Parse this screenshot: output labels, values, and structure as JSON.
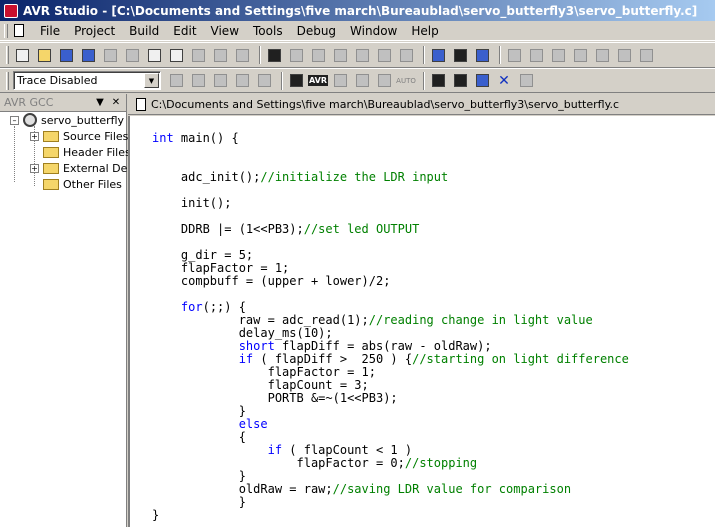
{
  "window": {
    "title": "AVR Studio - [C:\\Documents and Settings\\five march\\Bureaublad\\servo_butterfly3\\servo_butterfly.c]"
  },
  "menu": [
    {
      "label": "File"
    },
    {
      "label": "Project"
    },
    {
      "label": "Build"
    },
    {
      "label": "Edit"
    },
    {
      "label": "View"
    },
    {
      "label": "Tools"
    },
    {
      "label": "Debug"
    },
    {
      "label": "Window"
    },
    {
      "label": "Help"
    }
  ],
  "toolbar2": {
    "trace_value": "Trace Disabled",
    "avr_label": "AVR",
    "auto_label": "AUTO"
  },
  "panel": {
    "title": "AVR GCC",
    "project": "servo_butterfly",
    "folders": [
      "Source Files",
      "Header Files",
      "External Dep",
      "Other Files"
    ]
  },
  "editor": {
    "tab_label": "C:\\Documents and Settings\\five march\\Bureaublad\\servo_butterfly3\\servo_butterfly.c",
    "lines": [
      [
        {
          "t": "int",
          "k": "kw"
        },
        {
          "t": " main() {",
          "k": ""
        }
      ],
      [],
      [],
      [
        {
          "t": "    adc_init();",
          "k": ""
        },
        {
          "t": "//initialize the LDR input",
          "k": "cm"
        }
      ],
      [],
      [
        {
          "t": "    init();",
          "k": ""
        }
      ],
      [],
      [
        {
          "t": "    DDRB |= (1<<PB3);",
          "k": ""
        },
        {
          "t": "//set led OUTPUT",
          "k": "cm"
        }
      ],
      [],
      [
        {
          "t": "    g_dir = 5;",
          "k": ""
        }
      ],
      [
        {
          "t": "    flapFactor = 1;",
          "k": ""
        }
      ],
      [
        {
          "t": "    compbuff = (upper + lower)/2;",
          "k": ""
        }
      ],
      [],
      [
        {
          "t": "    ",
          "k": ""
        },
        {
          "t": "for",
          "k": "kw"
        },
        {
          "t": "(;;) {",
          "k": ""
        }
      ],
      [
        {
          "t": "            raw = adc_read(1);",
          "k": ""
        },
        {
          "t": "//reading change in light value",
          "k": "cm"
        }
      ],
      [
        {
          "t": "            delay_ms(10);",
          "k": ""
        }
      ],
      [
        {
          "t": "            ",
          "k": ""
        },
        {
          "t": "short",
          "k": "kw"
        },
        {
          "t": " flapDiff = abs(raw - oldRaw);",
          "k": ""
        }
      ],
      [
        {
          "t": "            ",
          "k": ""
        },
        {
          "t": "if",
          "k": "kw"
        },
        {
          "t": " ( flapDiff >  250 ) {",
          "k": ""
        },
        {
          "t": "//starting on light difference",
          "k": "cm"
        }
      ],
      [
        {
          "t": "                flapFactor = 1;",
          "k": ""
        }
      ],
      [
        {
          "t": "                flapCount = 3;",
          "k": ""
        }
      ],
      [
        {
          "t": "                PORTB &=~(1<<PB3);",
          "k": ""
        }
      ],
      [
        {
          "t": "            }",
          "k": ""
        }
      ],
      [
        {
          "t": "            ",
          "k": ""
        },
        {
          "t": "else",
          "k": "kw"
        }
      ],
      [
        {
          "t": "            {",
          "k": ""
        }
      ],
      [
        {
          "t": "                ",
          "k": ""
        },
        {
          "t": "if",
          "k": "kw"
        },
        {
          "t": " ( flapCount < 1 )",
          "k": ""
        }
      ],
      [
        {
          "t": "                    flapFactor = 0;",
          "k": ""
        },
        {
          "t": "//stopping",
          "k": "cm"
        }
      ],
      [
        {
          "t": "            }",
          "k": ""
        }
      ],
      [
        {
          "t": "            oldRaw = raw;",
          "k": ""
        },
        {
          "t": "//saving LDR value for comparison",
          "k": "cm"
        }
      ],
      [
        {
          "t": "            }",
          "k": ""
        }
      ],
      [
        {
          "t": "}",
          "k": ""
        }
      ]
    ]
  }
}
